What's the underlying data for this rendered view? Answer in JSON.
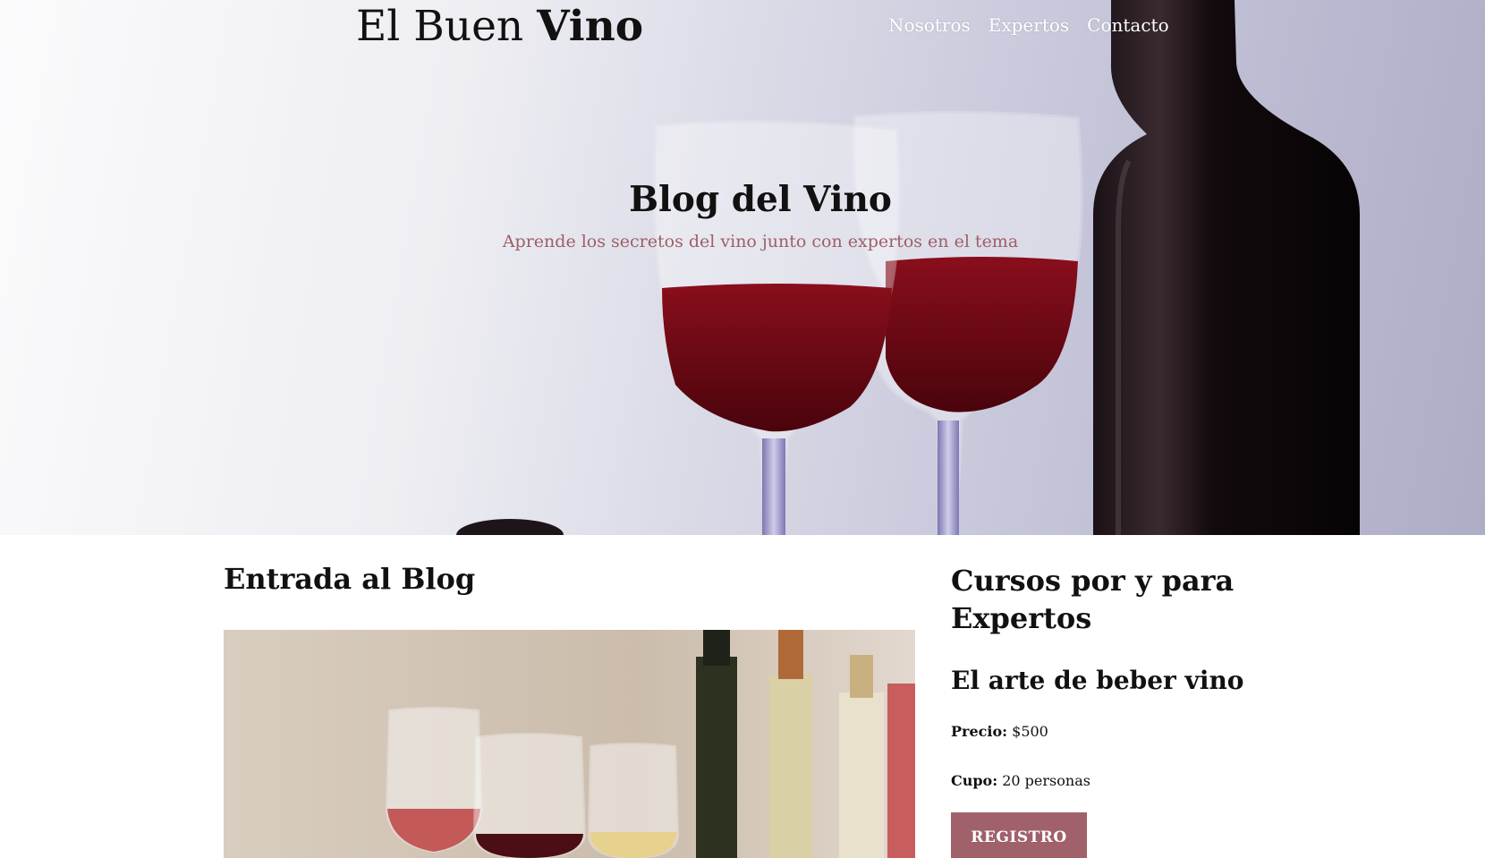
{
  "header": {
    "logo_light": "El Buen",
    "logo_bold": "Vino",
    "nav": [
      "Nosotros",
      "Expertos",
      "Contacto"
    ]
  },
  "hero": {
    "title": "Blog del Vino",
    "subtitle": "Aprende los secretos del vino junto con expertos en el tema"
  },
  "blog": {
    "heading": "Entrada al Blog"
  },
  "courses": {
    "heading": "Cursos por y para Expertos",
    "items": [
      {
        "title": "El arte de beber vino",
        "price_label": "Precio:",
        "price_value": "$500",
        "cupo_label": "Cupo:",
        "cupo_value": "20 personas",
        "button_label": "REGISTRO"
      }
    ]
  },
  "colors": {
    "accent": "#a0616a",
    "subtitle": "#9e5f66",
    "text": "#111111"
  }
}
